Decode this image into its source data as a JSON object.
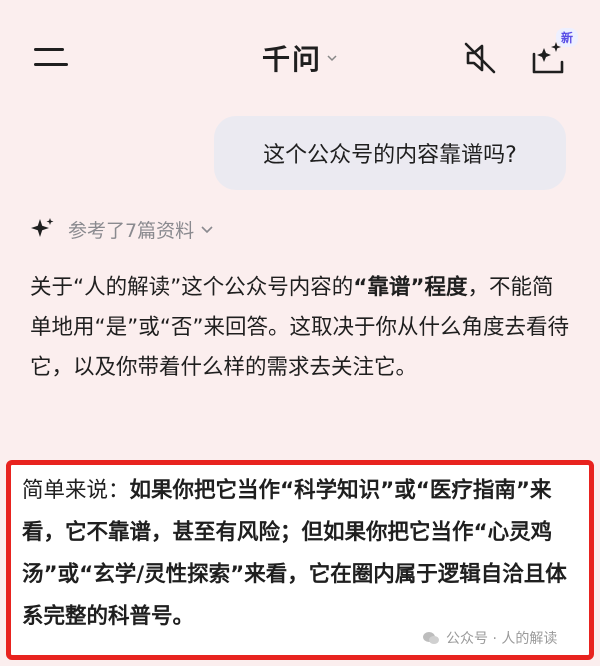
{
  "header": {
    "title": "千问",
    "new_badge": "新"
  },
  "chat": {
    "user_message": "这个公众号的内容靠谱吗?",
    "references_label": "参考了7篇资料",
    "answer": {
      "p1_a": "关于“人的解读”这个公众号内容的",
      "p1_bold": "“靠谱”程度",
      "p1_b": "，不能简单地用“是”或“否”来回答。这取决于你从什么角度去看待它，以及你带着什么样的需求去关注它。"
    },
    "highlight": {
      "lead": "简单来说：",
      "body": "如果你把它当作“科学知识”或“医疗指南”来看，它不靠谱，甚至有风险；但如果你把它当作“心灵鸡汤”或“玄学/灵性探索”来看，它在圈内属于逻辑自洽且体系完整的科普号。"
    }
  },
  "watermark": {
    "text": "公众号 · 人的解读"
  },
  "icons": {
    "menu": "menu-icon",
    "mute": "speaker-muted-icon",
    "new_chat": "new-chat-sparkle-icon",
    "references": "sparkle-icon"
  },
  "colors": {
    "background": "#fbeeee",
    "highlight_border": "#e8231f",
    "user_bubble": "#ebeaf1",
    "muted_text": "#8a8a8f"
  }
}
